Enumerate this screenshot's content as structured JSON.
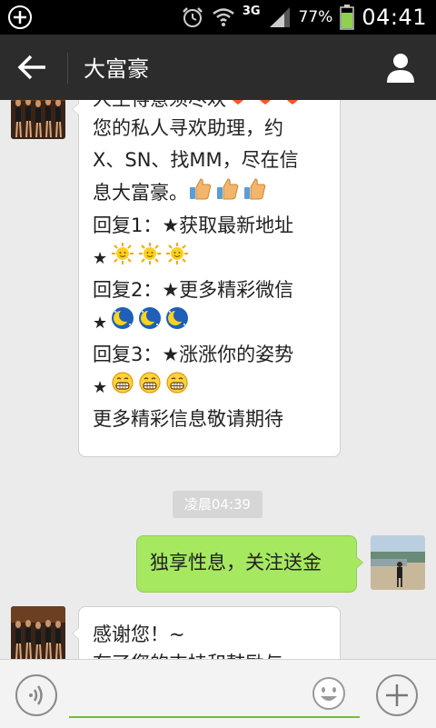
{
  "status_bar": {
    "network": "3G",
    "battery": "77%",
    "time": "04:41"
  },
  "header": {
    "title": "大富豪"
  },
  "messages": {
    "first": {
      "lines": [
        {
          "text": "人生得意须尽欢",
          "icons": [
            "heart",
            "heart",
            "heart"
          ]
        },
        {
          "text": "您的私人寻欢助理，约"
        },
        {
          "text": "X、SN、找MM，尽在信"
        },
        {
          "text": "息大富豪。",
          "icons": [
            "thumbs-up",
            "thumbs-up",
            "thumbs-up"
          ]
        },
        {
          "text": "回复1：★获取最新地址"
        },
        {
          "text": "★",
          "icons": [
            "sun",
            "sun",
            "sun"
          ]
        },
        {
          "text": "回复2：★更多精彩微信"
        },
        {
          "text": "★",
          "icons": [
            "moon",
            "moon",
            "moon"
          ]
        },
        {
          "text": "回复3：★涨涨你的姿势"
        },
        {
          "text": "★",
          "icons": [
            "grin",
            "grin",
            "grin"
          ]
        },
        {
          "text": "更多精彩信息敬请期待"
        }
      ]
    },
    "timestamp": "凌晨04:39",
    "sent": {
      "text": "独享性息，关注送金"
    },
    "second": {
      "lines": [
        {
          "text": "感谢您！~"
        },
        {
          "text": "有了您的支持和鼓励与"
        }
      ]
    }
  },
  "colors": {
    "header_bg": "#2c2c2c",
    "sent_bubble": "#a6e860",
    "input_underline": "#6fbf3b"
  }
}
